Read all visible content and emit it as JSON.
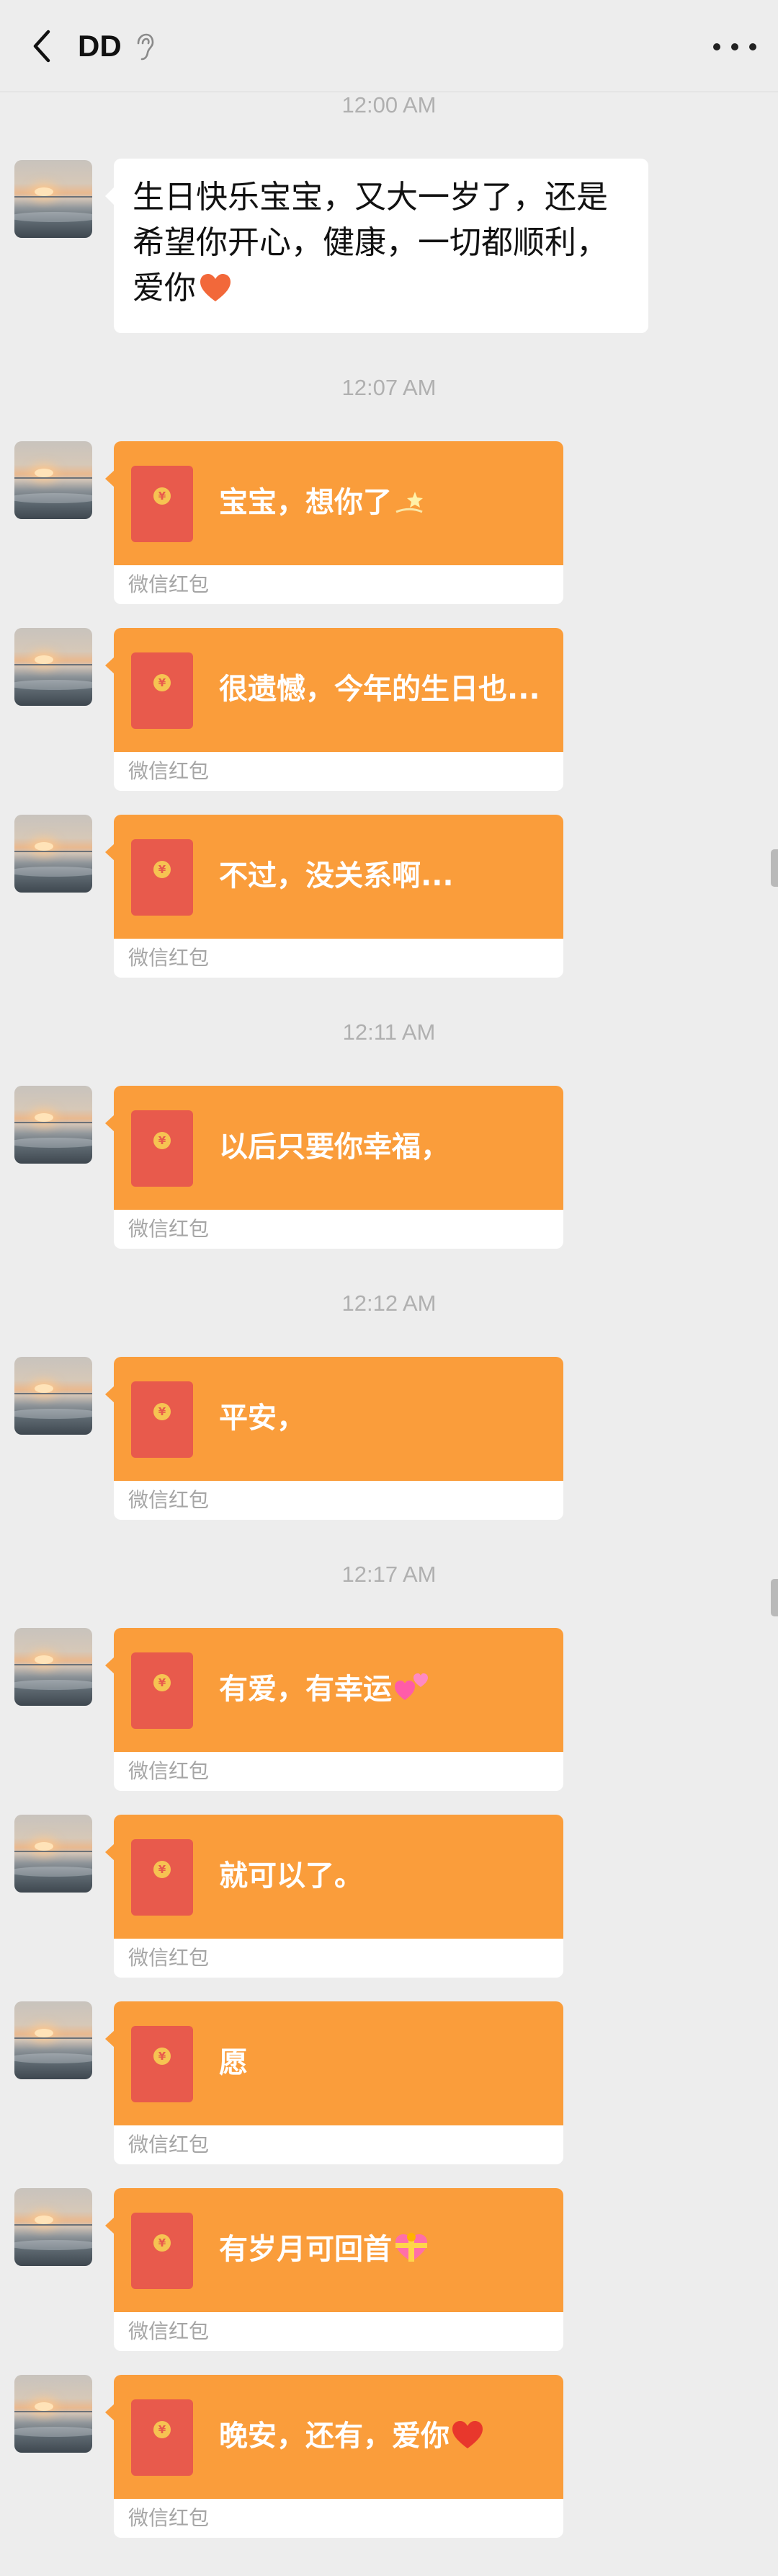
{
  "header": {
    "title": "DD",
    "back_icon": "chevron-left-icon",
    "mute_icon": "ear-icon",
    "more_icon": "more-dots-icon"
  },
  "timestamps": [
    "12:00 AM",
    "12:07 AM",
    "12:11 AM",
    "12:12 AM",
    "12:17 AM"
  ],
  "text_message": {
    "line1": "生日快乐宝宝，又大一岁了，还是",
    "line2": "希望你开心，健康，一切都顺利，",
    "line3": "爱你",
    "emoji": "orange-heart"
  },
  "red_packet_label": "微信红包",
  "red_packet_coin": "¥",
  "red_packets": [
    {
      "message": "宝宝，想你了",
      "emoji": "dizzy-star"
    },
    {
      "message": "很遗憾，今年的生日也...",
      "emoji": ""
    },
    {
      "message": "不过，没关系啊...",
      "emoji": ""
    },
    {
      "message": "以后只要你幸福，",
      "emoji": ""
    },
    {
      "message": "平安，",
      "emoji": ""
    },
    {
      "message": "有爱，有幸运",
      "emoji": "two-hearts"
    },
    {
      "message": "就可以了。",
      "emoji": ""
    },
    {
      "message": "愿",
      "emoji": ""
    },
    {
      "message": "有岁月可回首",
      "emoji": "heart-with-ribbon"
    },
    {
      "message": "晚安，还有，爱你",
      "emoji": "red-heart"
    }
  ],
  "colors": {
    "red_packet": "#fa9d3b",
    "envelope": "#e85a4c",
    "background": "#ededed"
  }
}
